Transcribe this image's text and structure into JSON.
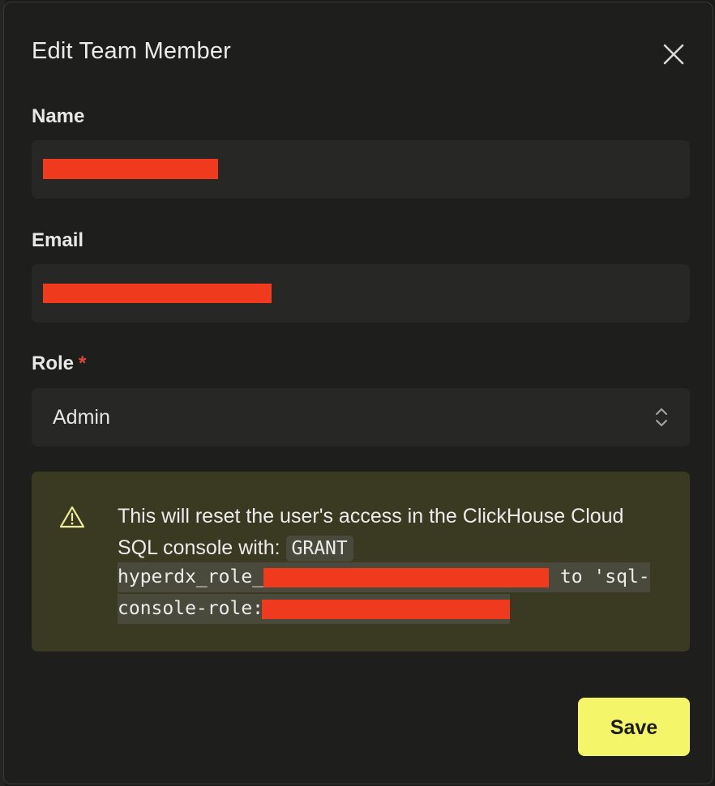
{
  "modal": {
    "title": "Edit Team Member",
    "close_icon": "close-icon"
  },
  "form": {
    "name_label": "Name",
    "email_label": "Email",
    "role_label": "Role",
    "role_required_marker": "*",
    "role_value": "Admin",
    "role_icon": "chevron-up-down-icon"
  },
  "alert": {
    "icon": "warning-triangle-icon",
    "text_line": "This will reset the user's access in the ClickHouse Cloud SQL console with:",
    "code_keyword": "GRANT",
    "code_line1_prefix": "hyperdx_role_",
    "code_line1_suffix": " to 'sql-",
    "code_line2_prefix": "console-role:"
  },
  "actions": {
    "save_label": "Save"
  },
  "colors": {
    "accent": "#f5f56a",
    "required": "#e0443a",
    "warning_bg": "#3a3921",
    "redaction": "#f03a1e"
  }
}
